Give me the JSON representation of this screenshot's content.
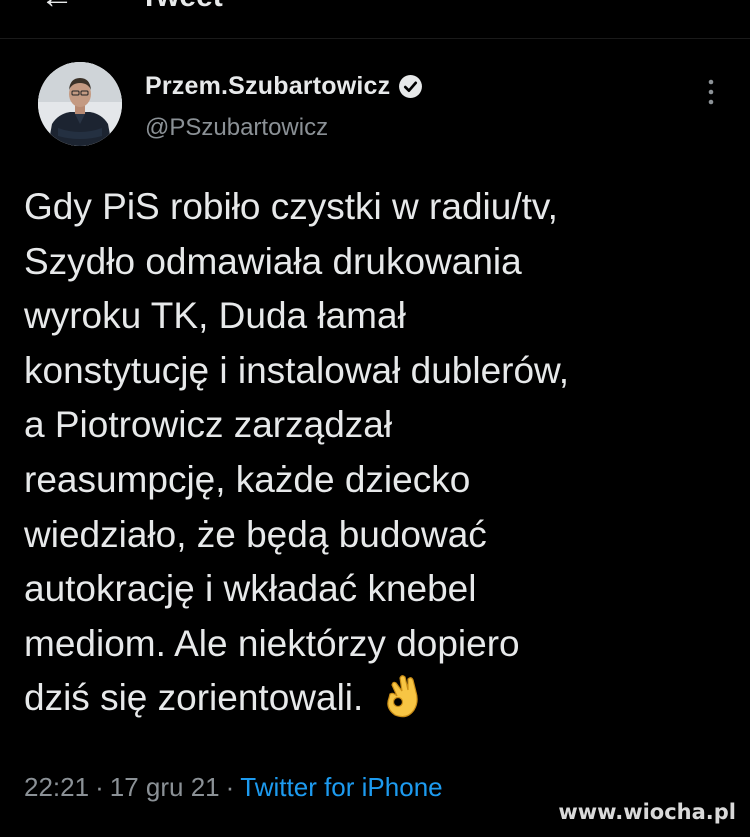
{
  "header": {
    "back_icon": "back-arrow-icon",
    "title": "Tweet"
  },
  "author": {
    "display_name": "Przem.Szubartowicz",
    "handle": "@PSzubartowicz",
    "verified_icon": "verified-badge-icon",
    "more_icon": "more-vertical-icon"
  },
  "tweet": {
    "lines": [
      "Gdy PiS robiło czystki w radiu/tv,",
      "Szydło odmawiała drukowania",
      "wyroku TK, Duda łamał",
      "konstytucję i instalował dublerów,",
      "a Piotrowicz zarządzał",
      "reasumpcję, każde dziecko",
      "wiedziało, że będą budować",
      "autokrację i wkładać knebel",
      "mediom. Ale niektórzy dopiero",
      "dziś się zorientowali."
    ],
    "emoji_icon": "ok-hand-emoji-icon"
  },
  "meta": {
    "time": "22:21",
    "separator": "·",
    "date": "17 gru 21",
    "source": "Twitter for iPhone"
  },
  "watermark": "www.wiocha.pl",
  "colors": {
    "background": "#000000",
    "text": "#e7e9ea",
    "secondary": "#8b9196",
    "link": "#1d9bf0"
  }
}
